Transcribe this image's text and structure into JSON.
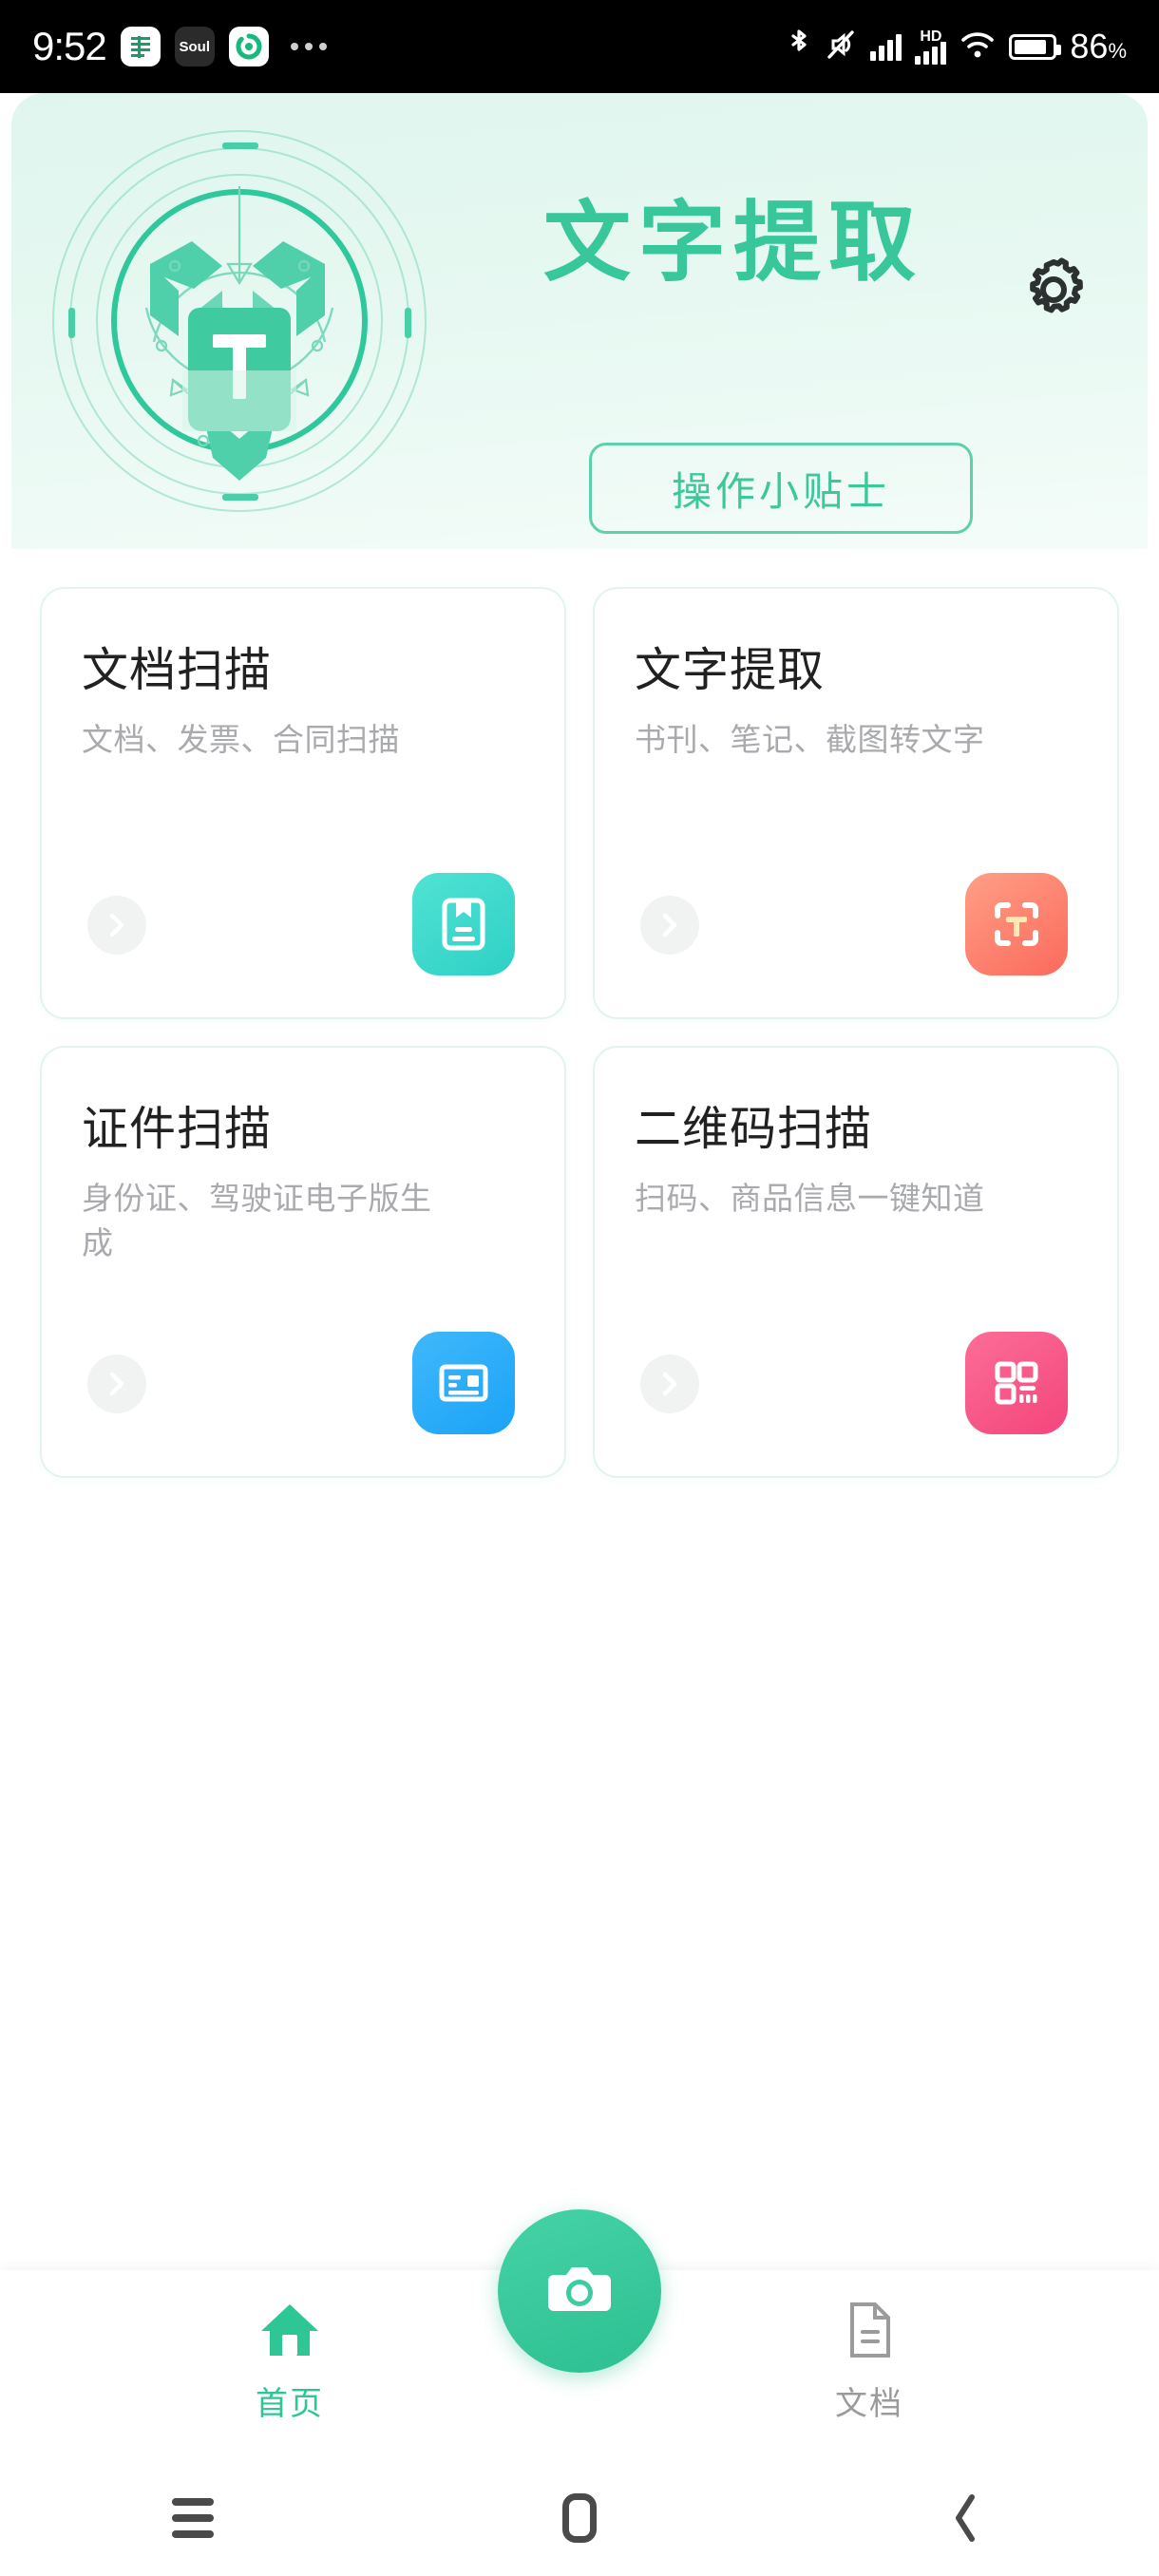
{
  "status_bar": {
    "time": "9:52",
    "app_icons": [
      "app-icon-green-e",
      "app-icon-soul",
      "app-icon-swirl"
    ],
    "soul_label": "Soul",
    "overflow": "more-dots-icon",
    "right_icons": [
      "bluetooth-icon",
      "mute-icon",
      "signal-icon",
      "hd-icon",
      "signal-2-icon",
      "wifi-icon",
      "battery-icon"
    ],
    "hd_label": "HD",
    "battery_percent": "86",
    "battery_unit": "%"
  },
  "header": {
    "title": "文字提取",
    "tips_button": "操作小贴士",
    "settings_icon": "gear-icon",
    "logo_icon": "text-extract-logo"
  },
  "cards": [
    {
      "title": "文档扫描",
      "subtitle": "文档、发票、合同扫描",
      "icon": "document-scan-icon",
      "icon_class": "ic-doc",
      "accent": "#2fd0c6"
    },
    {
      "title": "文字提取",
      "subtitle": "书刊、笔记、截图转文字",
      "icon": "text-extract-icon",
      "icon_class": "ic-text",
      "accent": "#fb6a5c"
    },
    {
      "title": "证件扫描",
      "subtitle": "身份证、驾驶证电子版生成",
      "icon": "id-card-scan-icon",
      "icon_class": "ic-id",
      "accent": "#1ba3f7"
    },
    {
      "title": "二维码扫描",
      "subtitle": "扫码、商品信息一键知道",
      "icon": "qr-code-scan-icon",
      "icon_class": "ic-qr",
      "accent": "#f4457c"
    }
  ],
  "bottom_nav": {
    "home_label": "首页",
    "home_icon": "home-icon",
    "docs_label": "文档",
    "docs_icon": "document-icon",
    "camera_icon": "camera-icon",
    "active_color": "#2ec695",
    "inactive_color": "#9b9b9b"
  },
  "android_nav": {
    "recents": "recents-icon",
    "home": "home-square-icon",
    "back": "back-chevron-icon"
  }
}
